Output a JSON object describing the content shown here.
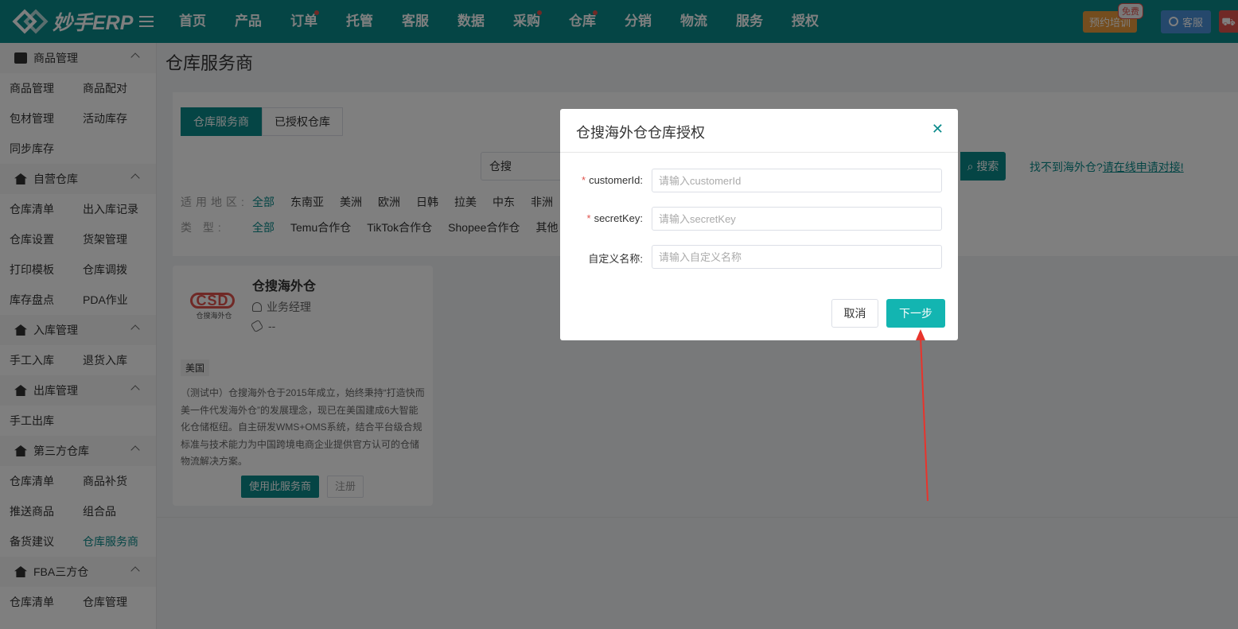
{
  "header": {
    "logo_text": "妙手ERP",
    "nav": [
      {
        "label": "首页",
        "dot": false
      },
      {
        "label": "产品",
        "dot": false
      },
      {
        "label": "订单",
        "dot": true
      },
      {
        "label": "托管",
        "dot": false
      },
      {
        "label": "客服",
        "dot": false
      },
      {
        "label": "数据",
        "dot": false
      },
      {
        "label": "采购",
        "dot": true
      },
      {
        "label": "仓库",
        "dot": true
      },
      {
        "label": "分销",
        "dot": false
      },
      {
        "label": "物流",
        "dot": false
      },
      {
        "label": "服务",
        "dot": false
      },
      {
        "label": "授权",
        "dot": false
      }
    ],
    "train_label": "预约培训",
    "free_badge": "免费",
    "kefu_label": "客服"
  },
  "sidebar": {
    "sections": [
      {
        "title": "商品管理",
        "icon": "box-icon",
        "items": [
          "商品管理",
          "商品配对",
          "包材管理",
          "活动库存",
          "同步库存"
        ]
      },
      {
        "title": "自营仓库",
        "icon": "house-icon",
        "items": [
          "仓库清单",
          "出入库记录",
          "仓库设置",
          "货架管理",
          "打印模板",
          "仓库调拨",
          "库存盘点",
          "PDA作业"
        ]
      },
      {
        "title": "入库管理",
        "icon": "house-icon",
        "items": [
          "手工入库",
          "退货入库"
        ]
      },
      {
        "title": "出库管理",
        "icon": "house-icon",
        "items": [
          "手工出库"
        ]
      },
      {
        "title": "第三方仓库",
        "icon": "warehouse-icon",
        "items": [
          "仓库清单",
          "商品补货",
          "推送商品",
          "组合品",
          "备货建议",
          "仓库服务商"
        ]
      },
      {
        "title": "FBA三方仓",
        "icon": "warehouse-icon",
        "items": [
          "仓库清单",
          "仓库管理"
        ]
      }
    ],
    "active_item": "仓库服务商"
  },
  "main": {
    "page_title": "仓库服务商",
    "tabs": [
      "仓库服务商",
      "已授权仓库"
    ],
    "search_value": "仓搜",
    "search_button": "搜索",
    "help_prefix": "找不到海外仓?",
    "help_link": "请在线申请对接!",
    "region_label": "适用地区:",
    "regions": [
      "全部",
      "东南亚",
      "美洲",
      "欧洲",
      "日韩",
      "拉美",
      "中东",
      "非洲"
    ],
    "type_label": "类 型:",
    "types": [
      "全部",
      "Temu合作仓",
      "TikTok合作仓",
      "Shopee合作仓",
      "其他"
    ],
    "card": {
      "logo_text": "CSD",
      "logo_sub": "仓搜海外仓",
      "name": "仓搜海外仓",
      "contact": "业务经理",
      "phone": "--",
      "tag": "美国",
      "desc": "（测试中）仓搜海外仓于2015年成立，始终秉持“打造快而美一件代发海外仓”的发展理念，现已在美国建成6大智能化仓储枢纽。自主研发WMS+OMS系统，结合平台级合规标准与技术能力为中国跨境电商企业提供官方认可的仓储物流解决方案。",
      "use_button": "使用此服务商",
      "register_button": "注册"
    }
  },
  "modal": {
    "title": "仓搜海外仓仓库授权",
    "fields": [
      {
        "label": "customerId:",
        "required": true,
        "placeholder": "请输入customerId",
        "value": ""
      },
      {
        "label": "secretKey:",
        "required": true,
        "placeholder": "请输入secretKey",
        "value": ""
      },
      {
        "label": "自定义名称:",
        "required": false,
        "placeholder": "请输入自定义名称",
        "value": ""
      }
    ],
    "cancel_label": "取消",
    "next_label": "下一步"
  },
  "colors": {
    "brand": "#0a8b8b",
    "primary_button": "#13b5b1",
    "danger": "#e0534d",
    "annotation_arrow": "#e8342c"
  }
}
